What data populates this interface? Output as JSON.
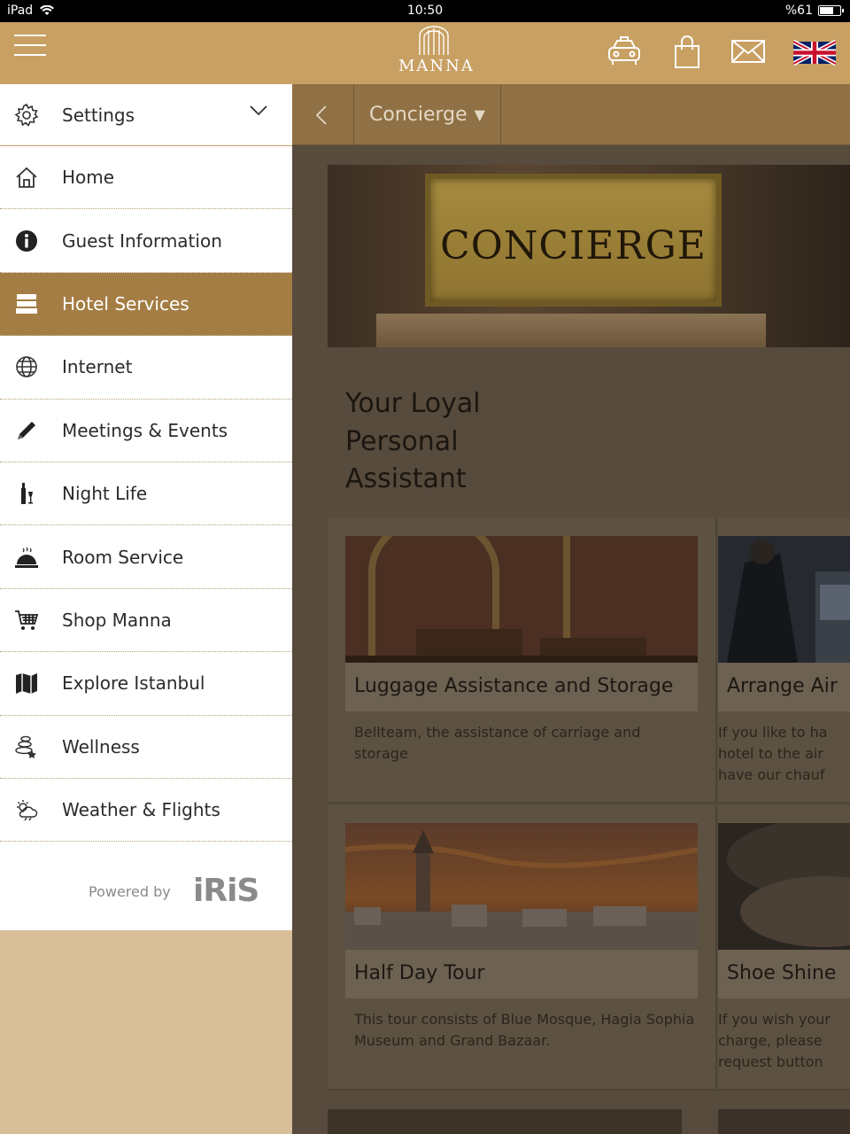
{
  "status_bar": {
    "device": "iPad",
    "time": "10:50",
    "battery": "%61"
  },
  "header": {
    "logo_text": "MANNA",
    "icons": [
      "taxi-icon",
      "shopping-bag-icon",
      "mail-icon",
      "uk-flag-icon"
    ]
  },
  "sidebar": {
    "settings_label": "Settings",
    "items": [
      {
        "label": "Home",
        "icon": "home-icon"
      },
      {
        "label": "Guest Information",
        "icon": "info-icon"
      },
      {
        "label": "Hotel Services",
        "icon": "bed-icon",
        "active": true
      },
      {
        "label": "Internet",
        "icon": "globe-icon"
      },
      {
        "label": "Meetings & Events",
        "icon": "pencil-icon"
      },
      {
        "label": "Night Life",
        "icon": "wine-icon"
      },
      {
        "label": "Room Service",
        "icon": "cloche-icon"
      },
      {
        "label": "Shop Manna",
        "icon": "cart-icon"
      },
      {
        "label": "Explore Istanbul",
        "icon": "map-icon"
      },
      {
        "label": "Wellness",
        "icon": "stones-icon"
      },
      {
        "label": "Weather & Flights",
        "icon": "weather-icon"
      }
    ],
    "powered_by": "Powered by",
    "brand": "iRiS"
  },
  "subnav": {
    "dropdown_label": "Concierge"
  },
  "hero": {
    "plaque_text": "CONCIERGE"
  },
  "tagline": "Your Loyal Personal Assistant",
  "cards": [
    {
      "title": "Luggage Assistance and Storage",
      "desc": "Bellteam, the assistance of carriage and storage"
    },
    {
      "title": "Arrange Air",
      "desc": "If you like to ha\nhotel to the air\nhave our chauf"
    },
    {
      "title": "Half Day Tour",
      "desc": "This tour consists of Blue Mosque, Hagia Sophia Museum and Grand Bazaar."
    },
    {
      "title": "Shoe Shine",
      "desc": "If you wish your\ncharge, please \nrequest button"
    }
  ],
  "colors": {
    "accent": "#c8a063",
    "active_menu": "#a47d44",
    "overlay": "#574b3d"
  }
}
